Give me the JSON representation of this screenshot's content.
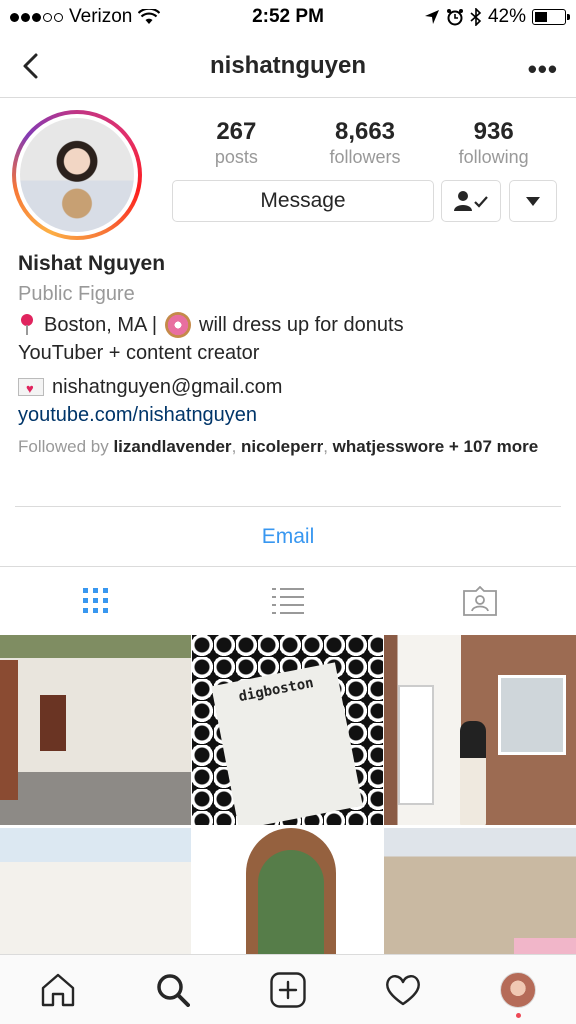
{
  "status_bar": {
    "carrier": "Verizon",
    "time": "2:52 PM",
    "battery": "42%",
    "battery_level": 0.42,
    "icons": [
      "signal-dots",
      "wifi-icon",
      "location-arrow-icon",
      "alarm-icon",
      "bluetooth-icon",
      "battery-icon"
    ]
  },
  "header": {
    "title": "nishatnguyen",
    "back_icon": "chevron-left-icon",
    "more_icon": "more-horizontal-icon",
    "more_label": "•••"
  },
  "profile": {
    "stats": [
      {
        "value": "267",
        "label": "posts"
      },
      {
        "value": "8,663",
        "label": "followers"
      },
      {
        "value": "936",
        "label": "following"
      }
    ],
    "message_button": "Message",
    "following_icon": "person-check-icon",
    "dropdown_icon": "caret-down-icon"
  },
  "bio": {
    "name": "Nishat Nguyen",
    "category": "Public Figure",
    "line1_location": "Boston, MA |",
    "line1_rest": "will dress up for donuts",
    "line2": "YouTuber + content creator",
    "email": "nishatnguyen@gmail.com",
    "link": "youtube.com/nishatnguyen",
    "followed_by_prefix": "Followed by",
    "followed_by_users": [
      "lizandlavender",
      "nicoleperr",
      "whatjesswore"
    ],
    "followed_by_more": "+ 107 more"
  },
  "contact": {
    "email_button": "Email"
  },
  "view_tabs": [
    {
      "name": "grid-view",
      "icon": "grid-icon",
      "active": true
    },
    {
      "name": "list-view",
      "icon": "list-icon",
      "active": false
    },
    {
      "name": "tagged-view",
      "icon": "tagged-user-icon",
      "active": false
    }
  ],
  "grid_posts": [
    {
      "name": "post-boston-brownstone",
      "note": ""
    },
    {
      "name": "post-digboston-paper",
      "note": "digboston"
    },
    {
      "name": "post-white-maxi-skirt",
      "note": ""
    },
    {
      "name": "post-london-buildings",
      "note": ""
    },
    {
      "name": "post-brick-archway",
      "note": ""
    },
    {
      "name": "post-pink-mews",
      "note": ""
    }
  ],
  "bottom_bar": [
    {
      "name": "home",
      "icon": "home-icon"
    },
    {
      "name": "search",
      "icon": "search-icon"
    },
    {
      "name": "new-post",
      "icon": "plus-square-icon"
    },
    {
      "name": "activity",
      "icon": "heart-icon"
    },
    {
      "name": "profile",
      "icon": "profile-avatar"
    }
  ],
  "colors": {
    "link_blue": "#3897f0",
    "bio_link": "#003569",
    "secondary_text": "#999999",
    "primary_text": "#262626",
    "notification_dot": "#ed4956"
  }
}
